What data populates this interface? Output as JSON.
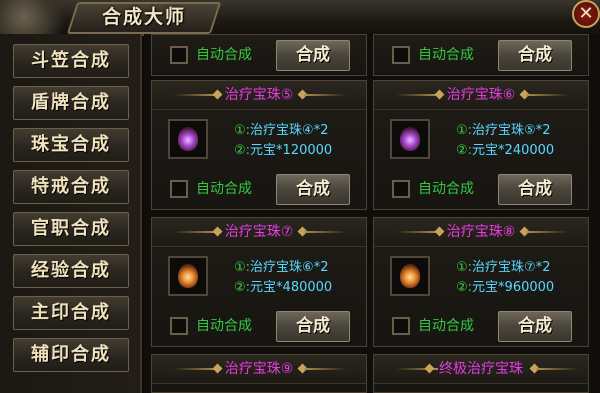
{
  "window": {
    "title": "合成大师",
    "close_label": "✕"
  },
  "sidebar": {
    "items": [
      {
        "label": "斗笠合成"
      },
      {
        "label": "盾牌合成"
      },
      {
        "label": "珠宝合成"
      },
      {
        "label": "特戒合成"
      },
      {
        "label": "官职合成"
      },
      {
        "label": "经验合成"
      },
      {
        "label": "主印合成"
      },
      {
        "label": "辅印合成"
      }
    ]
  },
  "common": {
    "auto_label": "自动合成",
    "craft_label": "合成",
    "num1": "①:",
    "num2": "②:"
  },
  "cards": [
    {
      "title": "治疗宝珠⑤",
      "req1": "治疗宝珠④*2",
      "req2": "元宝*120000",
      "gem": "purple-orb-icon"
    },
    {
      "title": "治疗宝珠⑥",
      "req1": "治疗宝珠⑤*2",
      "req2": "元宝*240000",
      "gem": "purple-orb-icon"
    },
    {
      "title": "治疗宝珠⑦",
      "req1": "治疗宝珠⑥*2",
      "req2": "元宝*480000",
      "gem": "orange-orb-icon"
    },
    {
      "title": "治疗宝珠⑧",
      "req1": "治疗宝珠⑦*2",
      "req2": "元宝*960000",
      "gem": "orange-orb-icon"
    },
    {
      "title": "治疗宝珠⑨"
    },
    {
      "title": "终极治疗宝珠"
    }
  ],
  "colors": {
    "title_magenta": "#e33ce0",
    "auto_green": "#33c73f",
    "req_cyan": "#5ad8ff",
    "req_num_green": "#3fd14a"
  }
}
